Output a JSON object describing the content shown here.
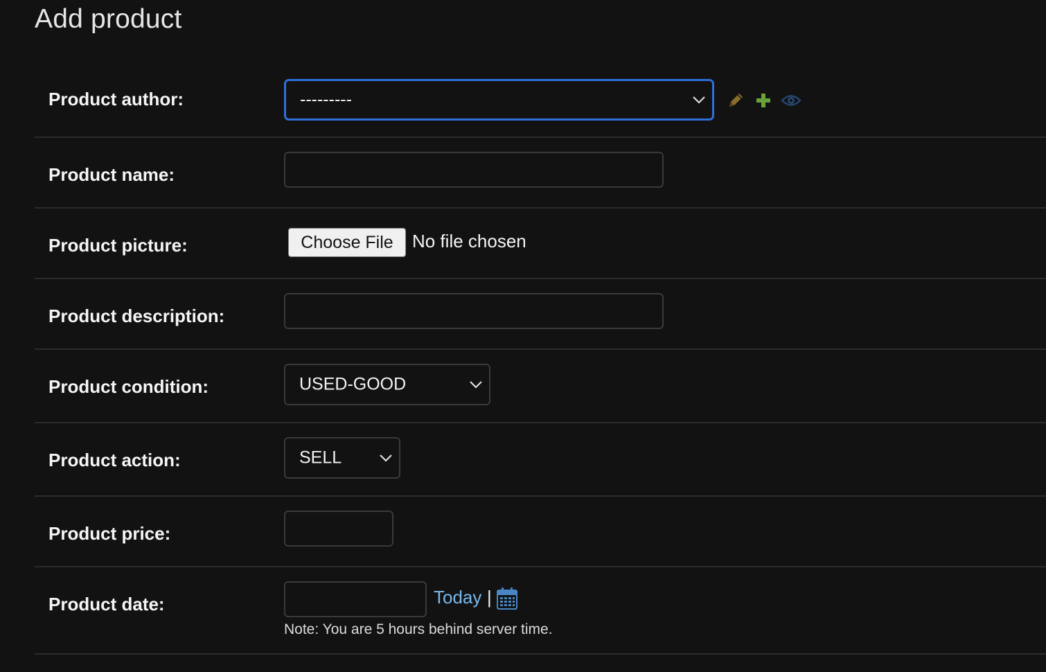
{
  "page": {
    "title": "Add product"
  },
  "fields": {
    "author": {
      "label": "Product author:",
      "selected": "---------",
      "icons": [
        "pencil-icon",
        "plus-icon",
        "eye-icon"
      ]
    },
    "name": {
      "label": "Product name:",
      "value": ""
    },
    "picture": {
      "label": "Product picture:",
      "button": "Choose File",
      "status": "No file chosen"
    },
    "description": {
      "label": "Product description:",
      "value": ""
    },
    "condition": {
      "label": "Product condition:",
      "selected": "USED-GOOD"
    },
    "action": {
      "label": "Product action:",
      "selected": "SELL"
    },
    "price": {
      "label": "Product price:",
      "value": ""
    },
    "date": {
      "label": "Product date:",
      "value": "",
      "today_link": "Today",
      "separator": "|",
      "note": "Note: You are 5 hours behind server time."
    }
  },
  "colors": {
    "background": "#121212",
    "focus_border": "#2f6fdb",
    "link": "#79b8ec",
    "add_icon": "#6aa33a",
    "edit_icon": "#8a6d2a",
    "view_icon": "#27466f"
  }
}
